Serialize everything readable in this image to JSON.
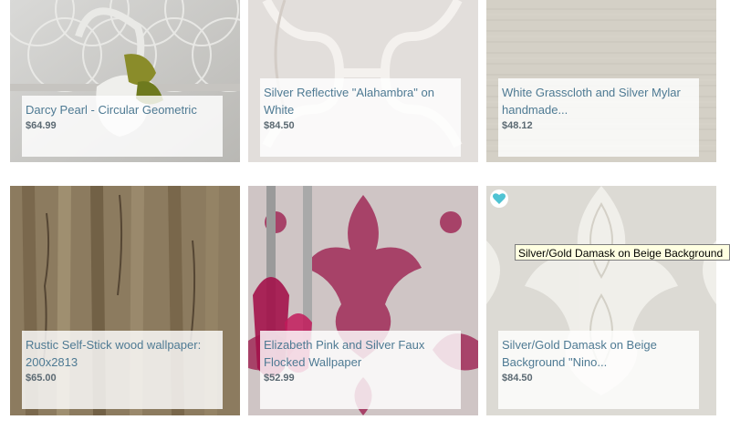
{
  "products": [
    {
      "title": "Darcy Pearl - Circular Geometric",
      "price": "$64.99"
    },
    {
      "title": "Silver Reflective \"Alahambra\" on White",
      "price": "$84.50"
    },
    {
      "title": "White Grasscloth and Silver Mylar handmade...",
      "price": "$48.12"
    },
    {
      "title": "Rustic Self-Stick wood wallpaper: 200x2813",
      "price": "$65.00"
    },
    {
      "title": "Elizabeth Pink and Silver Faux Flocked Wallpaper",
      "price": "$52.99"
    },
    {
      "title": "Silver/Gold Damask on Beige Background \"Nino...",
      "price": "$84.50"
    }
  ],
  "tooltip": {
    "text": "Silver/Gold Damask on Beige Background"
  },
  "colors": {
    "title_text": "#4e7a93",
    "price_text": "#5c6a73",
    "favorite_heart": "#4fc3d3",
    "tooltip_bg": "#ffffe1"
  },
  "icons": {
    "favorite": "heart-icon"
  }
}
